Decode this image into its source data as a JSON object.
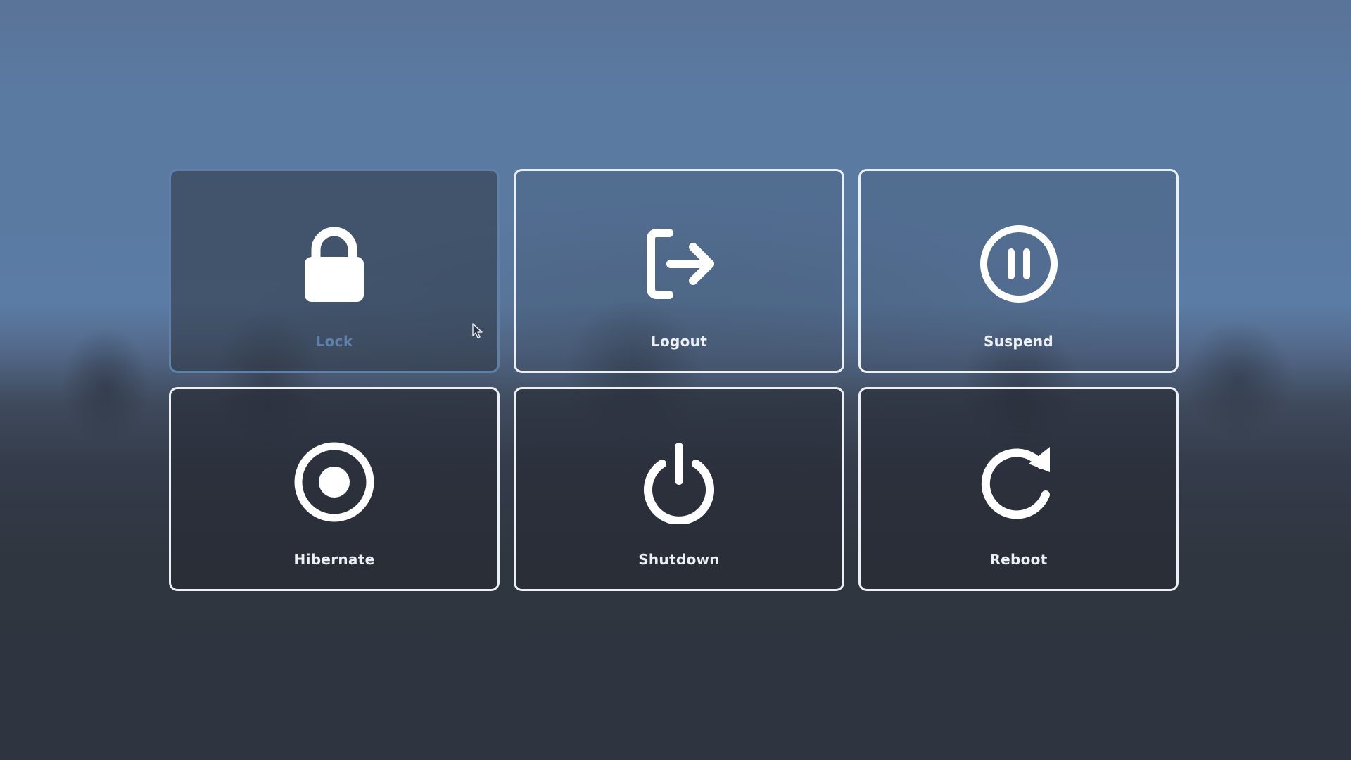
{
  "menu": {
    "items": [
      {
        "label": "Lock",
        "icon": "lock-icon",
        "selected": true
      },
      {
        "label": "Logout",
        "icon": "logout-icon",
        "selected": false
      },
      {
        "label": "Suspend",
        "icon": "pause-circle-icon",
        "selected": false
      },
      {
        "label": "Hibernate",
        "icon": "record-circle-icon",
        "selected": false
      },
      {
        "label": "Shutdown",
        "icon": "power-icon",
        "selected": false
      },
      {
        "label": "Reboot",
        "icon": "reboot-icon",
        "selected": false
      }
    ]
  },
  "colors": {
    "border": "#eceff4",
    "selected_accent": "#5e81ac",
    "text": "#eceff4",
    "background_dark": "#2e3440",
    "sky": "#5b7aa1"
  }
}
